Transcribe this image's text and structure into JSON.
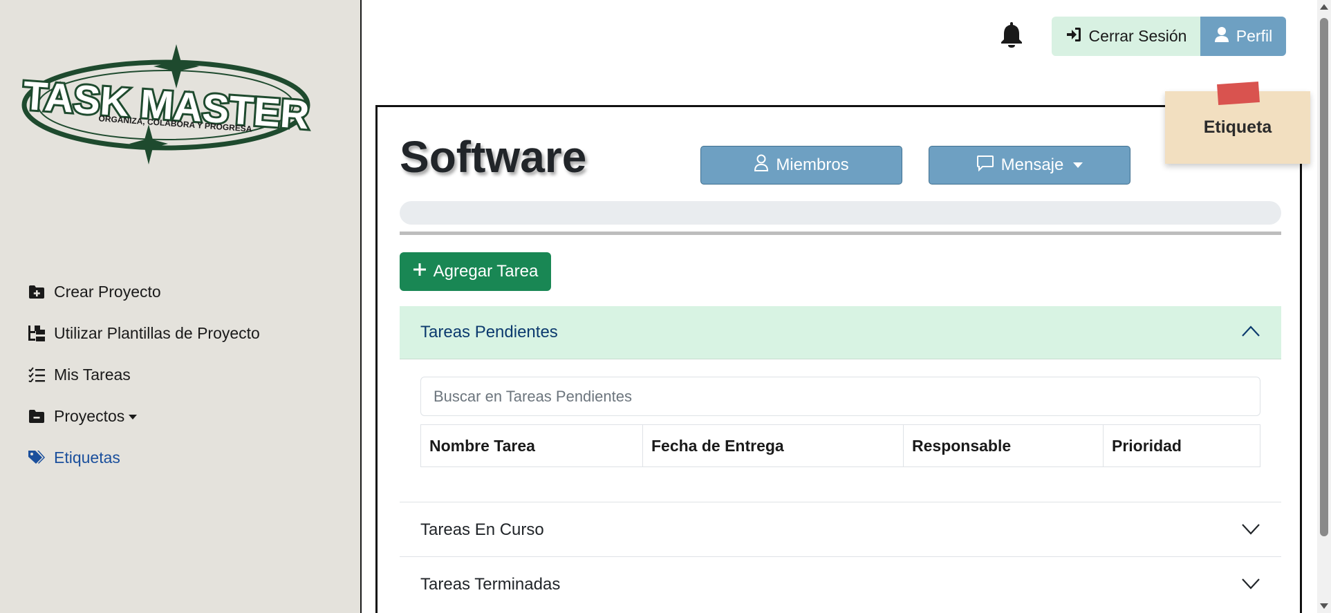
{
  "logo": {
    "title": "TASK MASTER",
    "tagline": "ORGANIZA, COLABORA Y PROGRESA"
  },
  "sidebar": {
    "items": [
      {
        "label": "Crear Proyecto",
        "icon": "folder-plus-icon"
      },
      {
        "label": "Utilizar Plantillas de Proyecto",
        "icon": "diagram-tree-icon"
      },
      {
        "label": "Mis Tareas",
        "icon": "list-check-icon"
      },
      {
        "label": "Proyectos",
        "icon": "folder-minus-icon"
      },
      {
        "label": "Etiquetas",
        "icon": "tags-icon"
      }
    ]
  },
  "header": {
    "logout_label": "Cerrar Sesión",
    "profile_label": "Perfil"
  },
  "sticky_note": {
    "label": "Etiqueta"
  },
  "project": {
    "title": "Software",
    "members_label": "Miembros",
    "message_label": "Mensaje",
    "progress_fraction": 0.0,
    "add_task_label": "Agregar Tarea"
  },
  "sections": {
    "pending": {
      "label": "Tareas Pendientes",
      "search_placeholder": "Buscar en Tareas Pendientes",
      "columns": [
        "Nombre Tarea",
        "Fecha de Entrega",
        "Responsable",
        "Prioridad"
      ]
    },
    "in_progress": {
      "label": "Tareas En Curso"
    },
    "done": {
      "label": "Tareas Terminadas"
    }
  },
  "colors": {
    "sidebar_bg": "#e4e2dc",
    "accent_blue": "#6ea0c2",
    "success_green": "#198754",
    "logout_bg": "#d8f1e2",
    "active_link": "#1a4f9c",
    "logo_green": "#1e4a2e"
  }
}
